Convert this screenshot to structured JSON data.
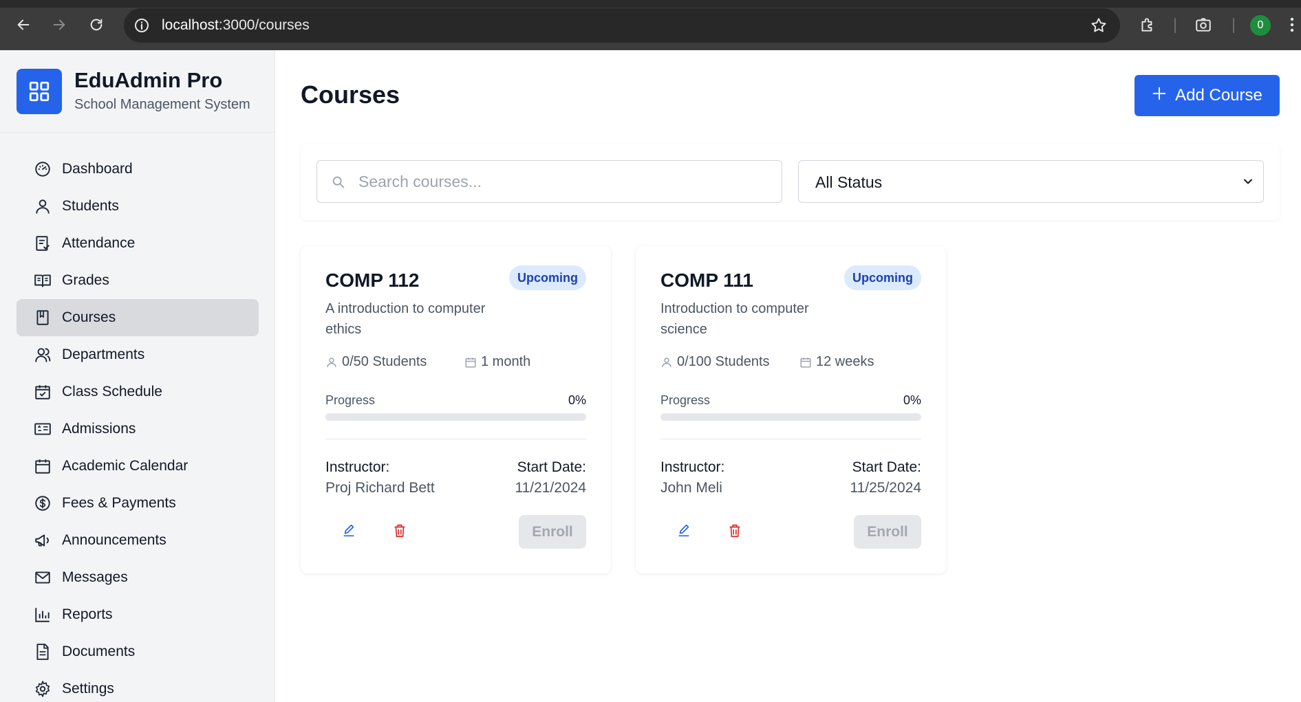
{
  "browser": {
    "url_host": "localhost",
    "url_path": ":3000/courses",
    "profile_initial": "0"
  },
  "sidebar": {
    "brand_title": "EduAdmin Pro",
    "brand_subtitle": "School Management System",
    "items": [
      {
        "label": "Dashboard",
        "icon": "gauge-icon"
      },
      {
        "label": "Students",
        "icon": "user-icon"
      },
      {
        "label": "Attendance",
        "icon": "clipboard-icon"
      },
      {
        "label": "Grades",
        "icon": "book-open-icon"
      },
      {
        "label": "Courses",
        "icon": "book-icon",
        "active": true
      },
      {
        "label": "Departments",
        "icon": "users-icon"
      },
      {
        "label": "Class Schedule",
        "icon": "calendar-check-icon"
      },
      {
        "label": "Admissions",
        "icon": "id-card-icon"
      },
      {
        "label": "Academic Calendar",
        "icon": "calendar-icon"
      },
      {
        "label": "Fees & Payments",
        "icon": "dollar-icon"
      },
      {
        "label": "Announcements",
        "icon": "megaphone-icon"
      },
      {
        "label": "Messages",
        "icon": "mail-icon"
      },
      {
        "label": "Reports",
        "icon": "bar-chart-icon"
      },
      {
        "label": "Documents",
        "icon": "file-icon"
      },
      {
        "label": "Settings",
        "icon": "gear-icon"
      }
    ]
  },
  "main": {
    "title": "Courses",
    "add_button_label": "Add Course",
    "search_placeholder": "Search courses...",
    "status_filter_value": "All Status"
  },
  "courses": [
    {
      "code": "COMP 112",
      "status": "Upcoming",
      "description": "A introduction to computer ethics",
      "students": "0/50 Students",
      "duration": "1 month",
      "progress_label": "Progress",
      "progress_value": "0%",
      "progress_fraction": 0,
      "instructor_label": "Instructor:",
      "instructor": "Proj Richard Bett",
      "start_label": "Start Date:",
      "start_date": "11/21/2024",
      "enroll_label": "Enroll"
    },
    {
      "code": "COMP 111",
      "status": "Upcoming",
      "description": "Introduction to computer science",
      "students": "0/100 Students",
      "duration": "12 weeks",
      "progress_label": "Progress",
      "progress_value": "0%",
      "progress_fraction": 0,
      "instructor_label": "Instructor:",
      "instructor": "John Meli",
      "start_label": "Start Date:",
      "start_date": "11/25/2024",
      "enroll_label": "Enroll"
    }
  ],
  "colors": {
    "accent": "#2563eb",
    "badge_bg": "#dbeafe",
    "badge_text": "#1e40af",
    "delete": "#dc2626"
  }
}
